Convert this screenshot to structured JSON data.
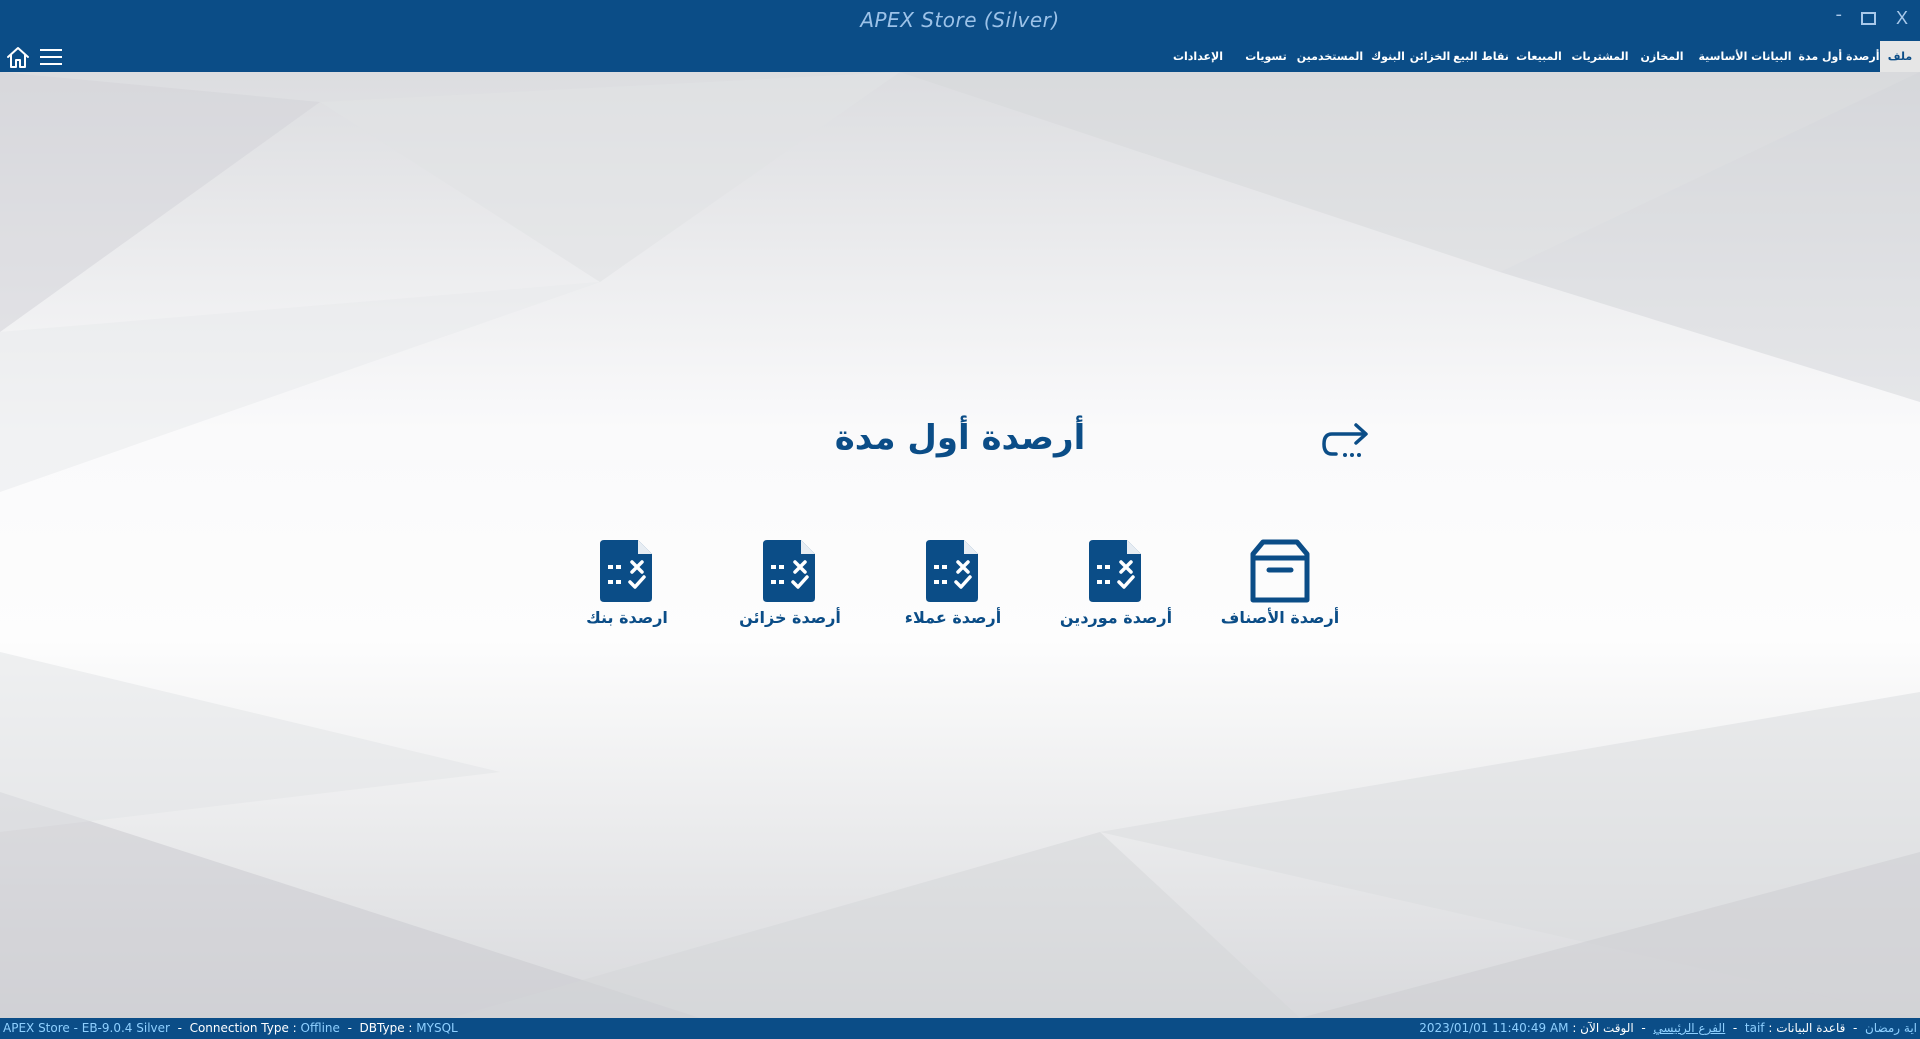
{
  "app": {
    "title": "APEX Store (Silver)",
    "window_controls": {
      "minimize": "-",
      "close": "X"
    }
  },
  "menu": {
    "items": [
      {
        "label": "ملف",
        "active": true
      },
      {
        "label": "أرصدة أول مدة"
      },
      {
        "label": "البيانات الأساسية"
      },
      {
        "label": "المخازن"
      },
      {
        "label": "المشتريات"
      },
      {
        "label": "المبيعات"
      },
      {
        "label": "نقاط البيع"
      },
      {
        "label": "الخزائن"
      },
      {
        "label": "البنوك"
      },
      {
        "label": "المستخدمين"
      },
      {
        "label": "تسويات"
      },
      {
        "label": "الإعدادات"
      }
    ]
  },
  "main": {
    "title": "أرصدة أول مدة",
    "back_icon": "return-arrow-icon",
    "tiles": [
      {
        "label": "أرصدة الأصناف",
        "icon": "box-icon"
      },
      {
        "label": "أرصدة موردين",
        "icon": "calculator-document-icon"
      },
      {
        "label": "أرصدة عملاء",
        "icon": "calculator-document-icon"
      },
      {
        "label": "أرصدة خزائن",
        "icon": "calculator-document-icon"
      },
      {
        "label": "ارصدة بنك",
        "icon": "calculator-document-icon"
      }
    ]
  },
  "status": {
    "version_label": "APEX Store - EB-9.0.4",
    "edition": "Silver",
    "connection_label": "Connection Type :",
    "connection_value": "Offline",
    "dbtype_label": "DBType :",
    "dbtype_value": "MYSQL",
    "user": "اية رمضان",
    "database_label": "قاعدة البيانات :",
    "database_value": "taif",
    "branch": "الفرع الرئيسي",
    "time_label": "الوقت الآن :",
    "time_value": "2023/01/01 11:40:49 AM"
  },
  "colors": {
    "primary": "#0b4d87",
    "accent_text": "#8fd0ff",
    "background": "#f4f4f5"
  }
}
